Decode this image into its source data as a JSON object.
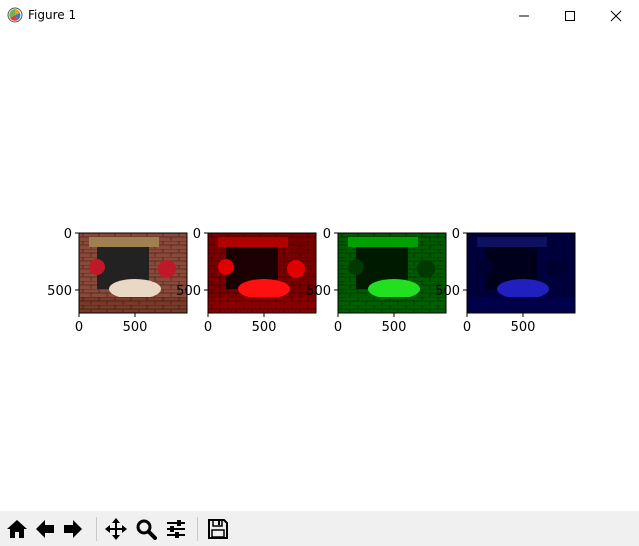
{
  "window": {
    "title": "Figure 1"
  },
  "icons": {
    "app": "matplotlib-icon",
    "minimize": "minimize-icon",
    "maximize": "maximize-icon",
    "close": "close-icon",
    "home": "home-icon",
    "back": "arrow-left-icon",
    "forward": "arrow-right-icon",
    "pan": "move-icon",
    "zoom": "magnifier-icon",
    "configure": "sliders-icon",
    "save": "floppy-disk-icon"
  },
  "subplots": [
    {
      "channel": "rgb",
      "tint": "#c8a89a",
      "xticks": [
        "0",
        "500"
      ],
      "yticks": [
        "0",
        "500"
      ]
    },
    {
      "channel": "red",
      "tint": "#d40000",
      "xticks": [
        "0",
        "500"
      ],
      "yticks": [
        "0",
        "500"
      ]
    },
    {
      "channel": "green",
      "tint": "#00b400",
      "xticks": [
        "0",
        "500"
      ],
      "yticks": [
        "0",
        "500"
      ]
    },
    {
      "channel": "blue",
      "tint": "#1a1ad0",
      "xticks": [
        "0",
        "500"
      ],
      "yticks": [
        "0",
        "500"
      ]
    }
  ]
}
